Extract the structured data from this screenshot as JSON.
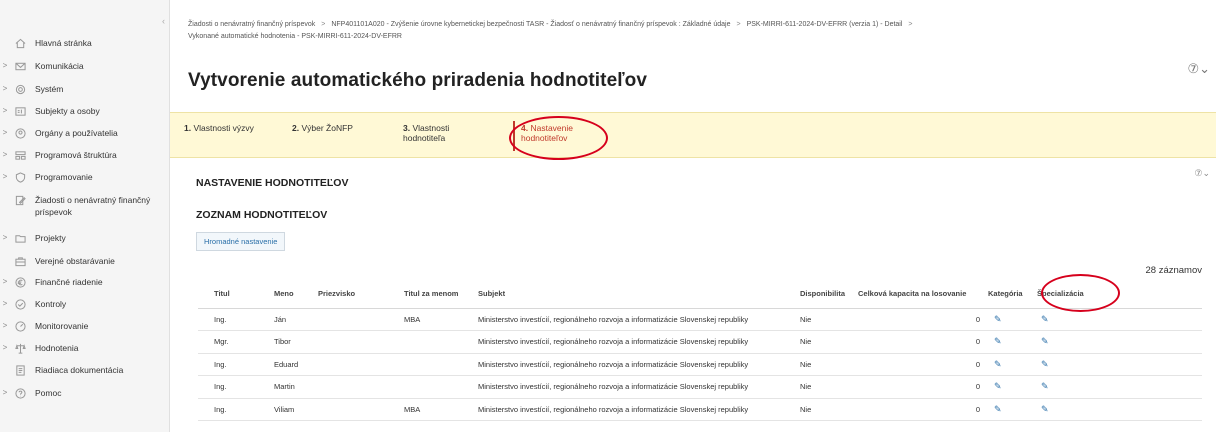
{
  "sidebar": {
    "items": [
      {
        "label": "Hlavná stránka",
        "icon": "home-icon",
        "arrow": ""
      },
      {
        "label": "Komunikácia",
        "icon": "mail-icon",
        "arrow": ">"
      },
      {
        "label": "Systém",
        "icon": "gear-icon",
        "arrow": ">"
      },
      {
        "label": "Subjekty a osoby",
        "icon": "id-card-icon",
        "arrow": ">"
      },
      {
        "label": "Orgány a používatelia",
        "icon": "user-circle-icon",
        "arrow": ">"
      },
      {
        "label": "Programová štruktúra",
        "icon": "structure-icon",
        "arrow": ">"
      },
      {
        "label": "Programovanie",
        "icon": "shield-icon",
        "arrow": ">"
      },
      {
        "label": "Žiadosti o nenávratný finančný príspevok",
        "icon": "edit-document-icon",
        "arrow": ""
      },
      {
        "label": "Projekty",
        "icon": "folder-icon",
        "arrow": ">"
      },
      {
        "label": "Verejné obstarávanie",
        "icon": "briefcase-icon",
        "arrow": ""
      },
      {
        "label": "Finančné riadenie",
        "icon": "euro-icon",
        "arrow": ">"
      },
      {
        "label": "Kontroly",
        "icon": "check-circle-icon",
        "arrow": ">"
      },
      {
        "label": "Monitorovanie",
        "icon": "gauge-icon",
        "arrow": ">"
      },
      {
        "label": "Hodnotenia",
        "icon": "scale-icon",
        "arrow": ">"
      },
      {
        "label": "Riadiaca dokumentácia",
        "icon": "document-icon",
        "arrow": ""
      },
      {
        "label": "Pomoc",
        "icon": "help-icon",
        "arrow": ">"
      }
    ]
  },
  "breadcrumb": {
    "items": [
      "Žiadosti o nenávratný finančný príspevok",
      "NFP401101A020 - Zvýšenie úrovne kybernetickej bezpečnosti TASR - Žiadosť o nenávratný finančný príspevok : Základné údaje",
      "PSK-MIRRI-611-2024-DV-EFRR (verzia 1) - Detail",
      "Vykonané automatické hodnotenia - PSK-MIRRI-611-2024-DV-EFRR"
    ]
  },
  "page": {
    "title": "Vytvorenie automatického priradenia hodnotiteľov",
    "help": "⑦⌄"
  },
  "steps": [
    {
      "num": "1.",
      "label": "Vlastnosti výzvy"
    },
    {
      "num": "2.",
      "label": "Výber ŽoNFP"
    },
    {
      "num": "3.",
      "label": "Vlastnosti",
      "label2": "hodnotiteľa"
    },
    {
      "num": "4.",
      "label": "Nastavenie",
      "label2": "hodnotiteľov"
    }
  ],
  "section": {
    "title": "NASTAVENIE HODNOTITEĽOV",
    "list_title": "ZOZNAM HODNOTITEĽOV",
    "bulk_button": "Hromadné nastavenie",
    "count": "28 záznamov",
    "help": "⑦⌄"
  },
  "table": {
    "headers": [
      "Titul",
      "Meno",
      "Priezvisko",
      "Titul za menom",
      "Subjekt",
      "Disponibilita",
      "Celková kapacita na losovanie",
      "Kategória",
      "Špecializácia"
    ],
    "rows": [
      {
        "titul": "Ing.",
        "meno": "Ján",
        "priezvisko": "",
        "titul_za": "MBA",
        "subjekt": "Ministerstvo investícií, regionálneho rozvoja a informatizácie Slovenskej republiky",
        "disponibilita": "Nie",
        "kapacita": "0"
      },
      {
        "titul": "Mgr.",
        "meno": "Tibor",
        "priezvisko": "",
        "titul_za": "",
        "subjekt": "Ministerstvo investícií, regionálneho rozvoja a informatizácie Slovenskej republiky",
        "disponibilita": "Nie",
        "kapacita": "0"
      },
      {
        "titul": "Ing.",
        "meno": "Eduard",
        "priezvisko": "",
        "titul_za": "",
        "subjekt": "Ministerstvo investícií, regionálneho rozvoja a informatizácie Slovenskej republiky",
        "disponibilita": "Nie",
        "kapacita": "0"
      },
      {
        "titul": "Ing.",
        "meno": "Martin",
        "priezvisko": "",
        "titul_za": "",
        "subjekt": "Ministerstvo investícií, regionálneho rozvoja a informatizácie Slovenskej republiky",
        "disponibilita": "Nie",
        "kapacita": "0"
      },
      {
        "titul": "Ing.",
        "meno": "Viliam",
        "priezvisko": "",
        "titul_za": "MBA",
        "subjekt": "Ministerstvo investícií, regionálneho rozvoja a informatizácie Slovenskej republiky",
        "disponibilita": "Nie",
        "kapacita": "0"
      }
    ]
  },
  "colors": {
    "accent_red": "#d6001c",
    "step_bg": "#fff9d6",
    "link_blue": "#2a6fa8"
  }
}
